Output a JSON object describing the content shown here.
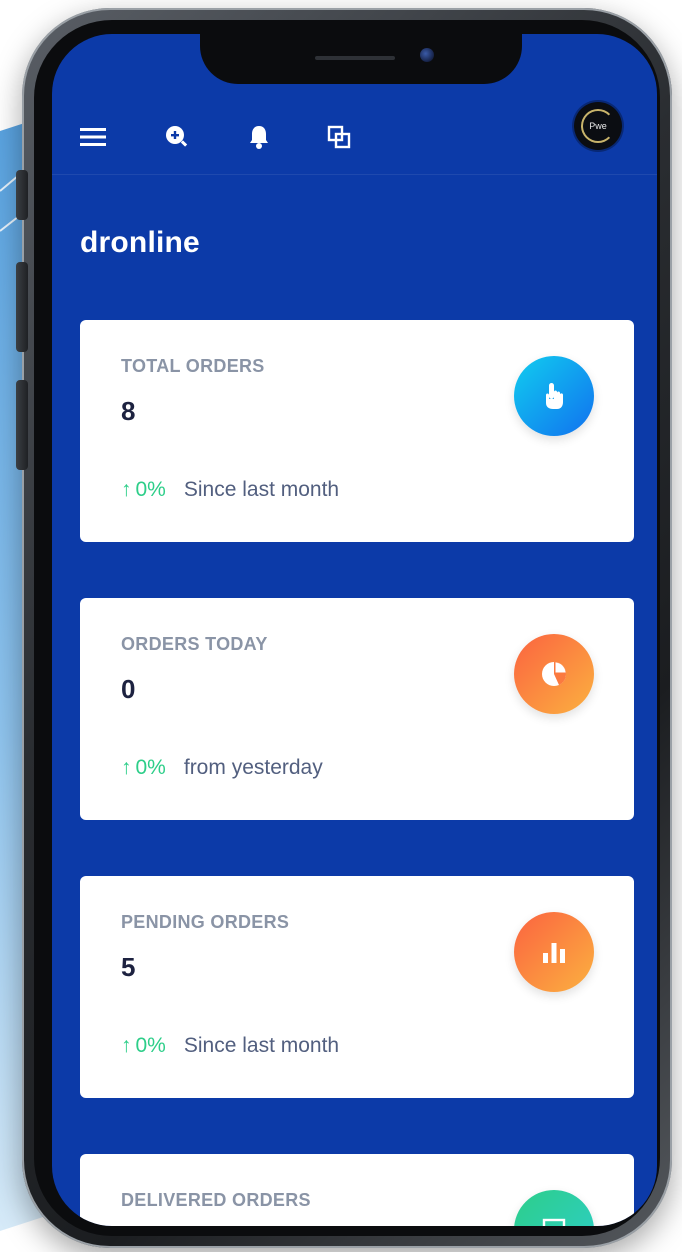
{
  "app": {
    "brand": "dronline",
    "avatar_label": "Pwe"
  },
  "colors": {
    "screen_bg": "#0c3aa8",
    "green": "#2dce89",
    "blue_icon": "#1da1f2",
    "orange_icon": "#fb6340",
    "teal_icon": "#2dce89"
  },
  "topbar": {
    "icons": [
      "menu-icon",
      "zoom-in-icon",
      "bell-icon",
      "copy-icon"
    ]
  },
  "cards": [
    {
      "title": "TOTAL ORDERS",
      "value": "8",
      "arrow": "↑",
      "percent": "0%",
      "note": "Since last month",
      "icon": "pointer-hand-icon"
    },
    {
      "title": "ORDERS TODAY",
      "value": "0",
      "arrow": "↑",
      "percent": "0%",
      "note": "from yesterday",
      "icon": "pie-chart-icon"
    },
    {
      "title": "PENDING ORDERS",
      "value": "5",
      "arrow": "↑",
      "percent": "0%",
      "note": "Since last month",
      "icon": "bar-chart-icon"
    },
    {
      "title": "DELIVERED ORDERS",
      "icon": "delivered-icon"
    }
  ]
}
